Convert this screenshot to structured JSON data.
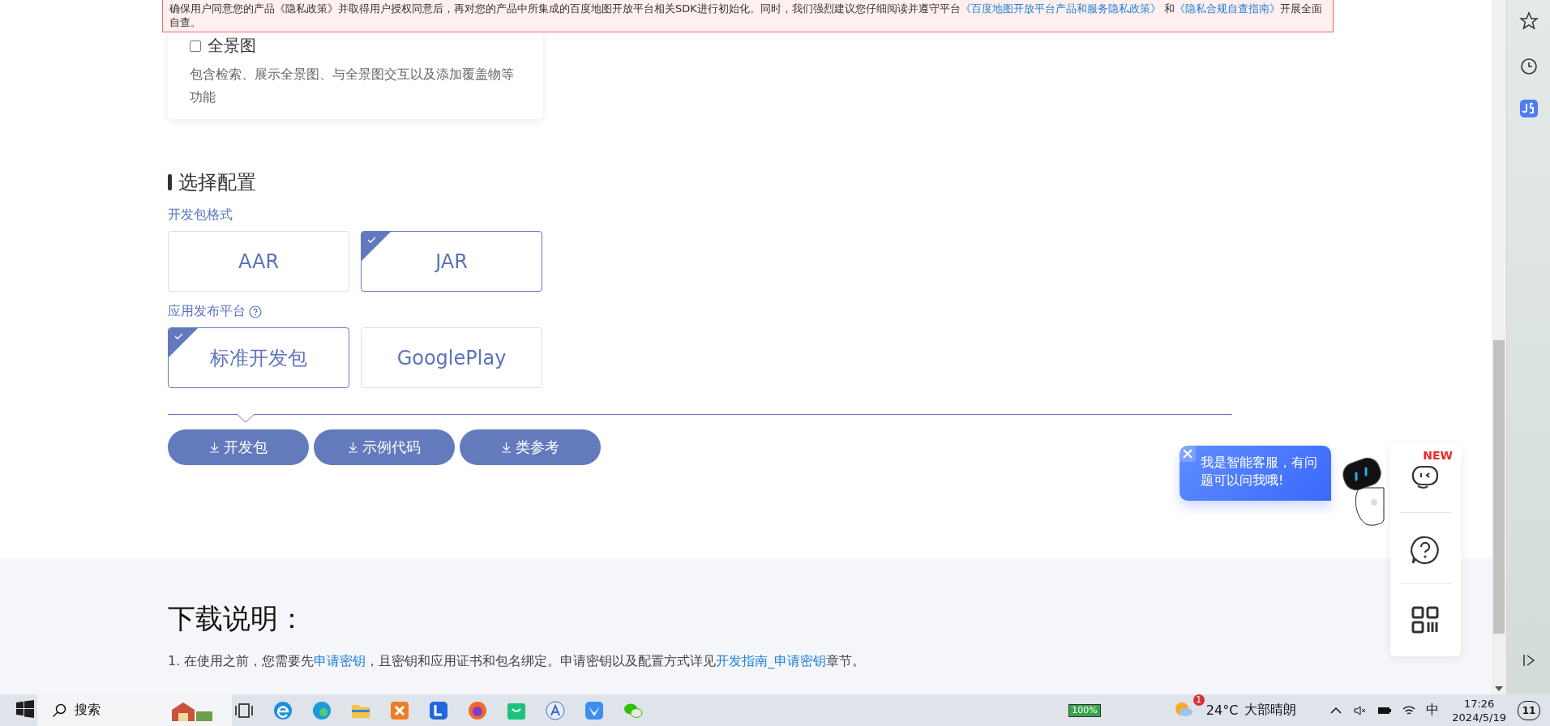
{
  "notice": {
    "segments": [
      {
        "text": "确保用户同意您的产品《隐私政策》并取得用户授权同意后，再对您的产品中所集成的百度地图开放平台相关SDK进行初始化。同时，我们强烈建议您仔细阅读并遵守平台",
        "kind": "text"
      },
      {
        "text": "《百度地图开放平台产品和服务隐私政策》",
        "kind": "link"
      },
      {
        "text": " 和",
        "kind": "text"
      },
      {
        "text": "《隐私合规自查指南》",
        "kind": "link"
      },
      {
        "text": "开展全面自查。",
        "kind": "text"
      }
    ]
  },
  "card": {
    "title": "全景图",
    "checked": false,
    "description": "包含检索、展示全景图、与全景图交互以及添加覆盖物等功能"
  },
  "config": {
    "heading": "选择配置",
    "groups": [
      {
        "label": "开发包格式",
        "help": false,
        "options": [
          {
            "label": "AAR",
            "selected": false
          },
          {
            "label": "JAR",
            "selected": true
          }
        ]
      },
      {
        "label": "应用发布平台",
        "help": true,
        "options": [
          {
            "label": "标准开发包",
            "selected": true
          },
          {
            "label": "GooglePlay",
            "selected": false
          }
        ]
      }
    ]
  },
  "downloads": [
    "开发包",
    "示例代码",
    "类参考"
  ],
  "instructions": {
    "heading": "下载说明：",
    "items": [
      [
        {
          "text": "1. 在使用之前，您需要先",
          "kind": "text"
        },
        {
          "text": "申请密钥",
          "kind": "link"
        },
        {
          "text": "，且密钥和应用证书和包名绑定。申请密钥以及配置方式详见",
          "kind": "text"
        },
        {
          "text": "开发指南_申请密钥",
          "kind": "link"
        },
        {
          "text": "章节。",
          "kind": "text"
        }
      ]
    ]
  },
  "chat": {
    "bubble": "我是智能客服，有问题可以问我哦!",
    "badge": "NEW"
  },
  "taskbar": {
    "search_placeholder": "搜索",
    "battery": "100%",
    "weather_badge": "1",
    "temperature": "24°C",
    "weather": "大部晴朗",
    "ime": "中",
    "time": "17:26",
    "date": "2024/5/19",
    "notifications": "11"
  }
}
